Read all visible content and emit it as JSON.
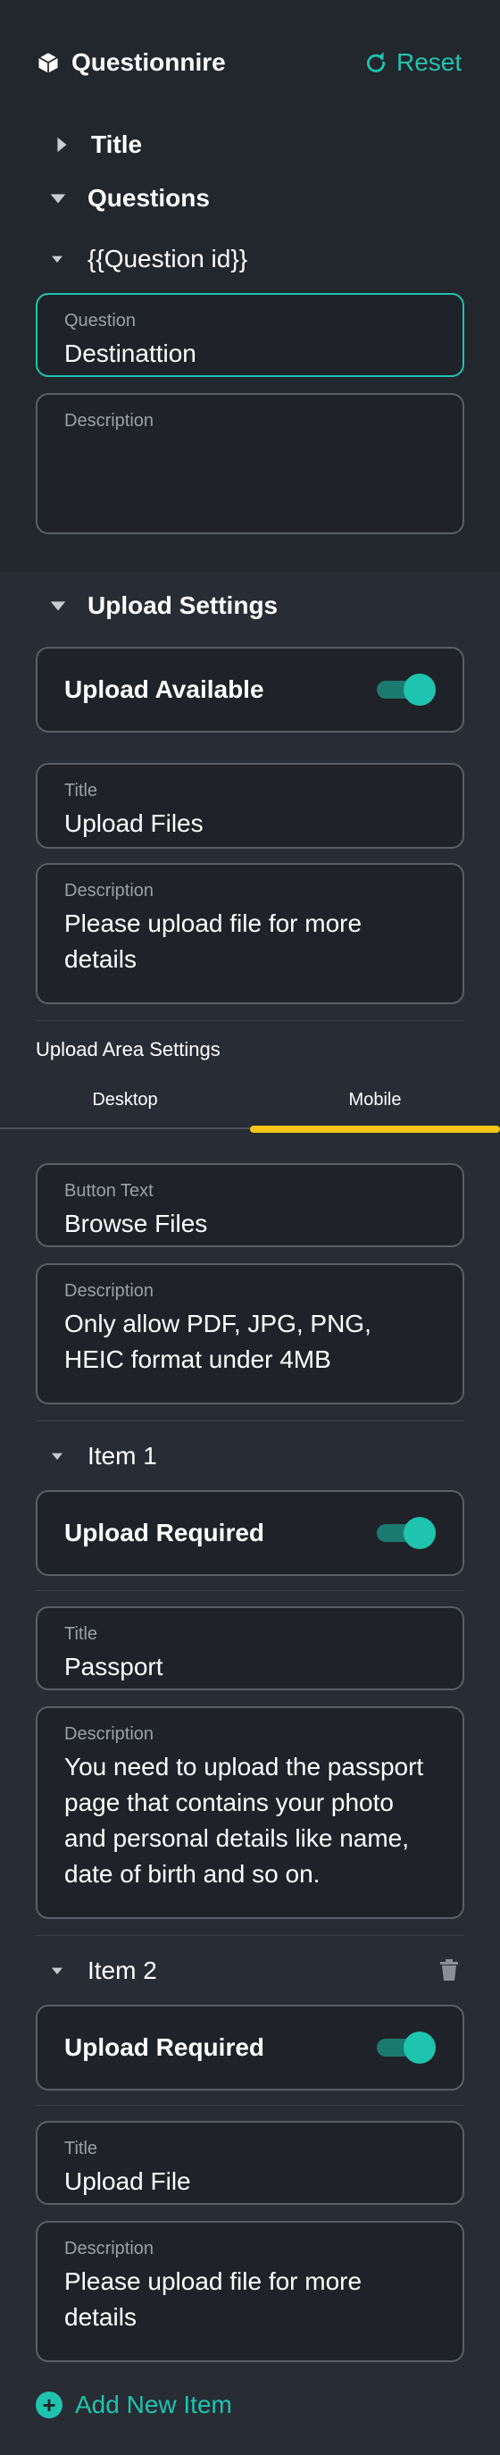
{
  "header": {
    "app_title": "Questionnire",
    "reset_label": "Reset"
  },
  "sections": {
    "title_label": "Title",
    "questions_label": "Questions",
    "question_id_label": "{{Question id}}",
    "upload_settings_label": "Upload Settings"
  },
  "question": {
    "question_label": "Question",
    "question_value": "Destinattion",
    "description_label": "Description",
    "description_value": ""
  },
  "upload_settings": {
    "available_label": "Upload Available",
    "title_label": "Title",
    "title_value": "Upload Files",
    "description_label": "Description",
    "description_value": "Please upload file for more details"
  },
  "upload_area": {
    "heading": "Upload Area Settings",
    "tabs": [
      "Desktop",
      "Mobile"
    ],
    "active_tab": "Mobile",
    "button_text_label": "Button Text",
    "button_text_value": "Browse Files",
    "description_label": "Description",
    "description_value": "Only allow PDF, JPG, PNG, HEIC format under 4MB"
  },
  "items": [
    {
      "name": "Item 1",
      "required_label": "Upload Required",
      "title_label": "Title",
      "title_value": "Passport",
      "description_label": "Description",
      "description_value": "You need to upload the passport page that contains your photo and personal details like name, date of birth and so on."
    },
    {
      "name": "Item 2",
      "required_label": "Upload Required",
      "title_label": "Title",
      "title_value": "Upload File",
      "description_label": "Description",
      "description_value": "Please upload file for more details"
    }
  ],
  "add_item_label": "Add New Item",
  "colors": {
    "accent": "#1fc4ae",
    "tab_indicator": "#f5c518",
    "background": "#282c34",
    "panel": "#22262d"
  }
}
